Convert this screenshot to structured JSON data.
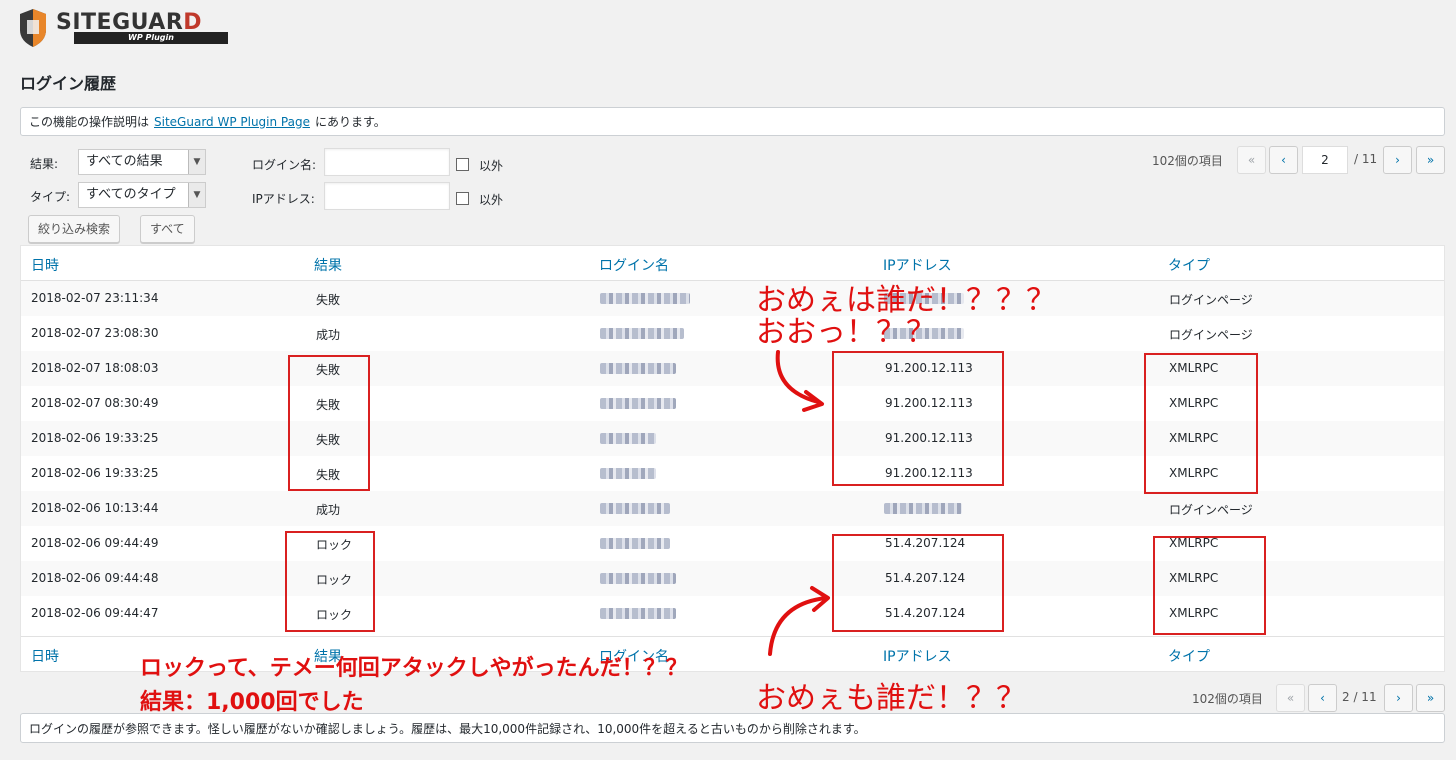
{
  "logo": {
    "brand_main": "SITEGUAR",
    "brand_d": "D",
    "sub": "WP Plugin"
  },
  "page_title": "ログイン履歴",
  "top_notice": {
    "before": "この機能の操作説明は",
    "link": "SiteGuard WP Plugin Page",
    "after": "にあります。"
  },
  "filters": {
    "result_label": "結果:",
    "result_value": "すべての結果",
    "type_label": "タイプ:",
    "type_value": "すべてのタイプ",
    "login_label": "ログイン名:",
    "ip_label": "IPアドレス:",
    "exclude_label": "以外",
    "search_button": "絞り込み検索",
    "all_button": "すべて"
  },
  "pagination_top": {
    "count": "102個の項目",
    "first": "«",
    "prev": "‹",
    "current": "2",
    "total": "/ 11",
    "next": "›",
    "last": "»"
  },
  "pagination_bottom": {
    "count": "102個の項目",
    "first": "«",
    "prev": "‹",
    "current": "2 / 11",
    "next": "›",
    "last": "»"
  },
  "columns": [
    "日時",
    "結果",
    "ログイン名",
    "IPアドレス",
    "タイプ"
  ],
  "rows": [
    {
      "datetime": "2018-02-07 23:11:34",
      "result": "失敗",
      "ip": "",
      "type": "ログインページ"
    },
    {
      "datetime": "2018-02-07 23:08:30",
      "result": "成功",
      "ip": "",
      "type": "ログインページ"
    },
    {
      "datetime": "2018-02-07 18:08:03",
      "result": "失敗",
      "ip": "91.200.12.113",
      "type": "XMLRPC"
    },
    {
      "datetime": "2018-02-07 08:30:49",
      "result": "失敗",
      "ip": "91.200.12.113",
      "type": "XMLRPC"
    },
    {
      "datetime": "2018-02-06 19:33:25",
      "result": "失敗",
      "ip": "91.200.12.113",
      "type": "XMLRPC"
    },
    {
      "datetime": "2018-02-06 19:33:25",
      "result": "失敗",
      "ip": "91.200.12.113",
      "type": "XMLRPC"
    },
    {
      "datetime": "2018-02-06 10:13:44",
      "result": "成功",
      "ip": "",
      "type": "ログインページ"
    },
    {
      "datetime": "2018-02-06 09:44:49",
      "result": "ロック",
      "ip": "51.4.207.124",
      "type": "XMLRPC"
    },
    {
      "datetime": "2018-02-06 09:44:48",
      "result": "ロック",
      "ip": "51.4.207.124",
      "type": "XMLRPC"
    },
    {
      "datetime": "2018-02-06 09:44:47",
      "result": "ロック",
      "ip": "51.4.207.124",
      "type": "XMLRPC"
    }
  ],
  "bottom_notice": "ログインの履歴が参照できます。怪しい履歴がないか確認しましょう。履歴は、最大10,000件記録され、10,000件を超えると古いものから削除されます。",
  "annotations": {
    "who1": "おめぇは誰だ！？？？",
    "oh": "おおっ！？？",
    "who2": "おめぇも誰だ！？？",
    "lock_question": "ロックって、テメー何回アタックしやがったんだ！？？",
    "result": "結果：1,000回でした"
  },
  "colors": {
    "accent": "#0073aa",
    "annotation": "#e01010"
  }
}
